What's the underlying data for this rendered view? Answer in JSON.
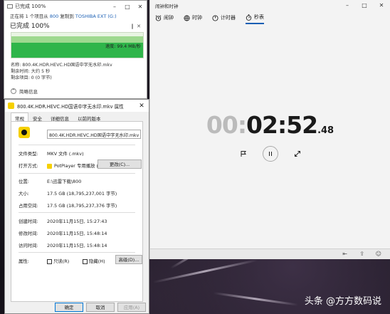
{
  "copy_dialog": {
    "title": "已完成 100%",
    "status_prefix": "正在将 1 个项目从 ",
    "source": "800",
    "status_mid": " 复制到 ",
    "destination": "TOSHIBA EXT (G:)",
    "percent_text": "已完成 100%",
    "speed": "速度: 99.4 MB/秒",
    "progress": 1.0,
    "name_line": "名称: 800.4K.HDR.HEVC.HD国语中字无水印.mkv",
    "remaining_time": "剩余时间: 大约 5 秒",
    "remaining_items": "剩余项目: 0 (0 字节)",
    "less_details": "简略信息"
  },
  "properties": {
    "title": "800.4K.HDR.HEVC.HD国语中字无水印.mkv 属性",
    "tabs": [
      "常规",
      "安全",
      "详细信息",
      "以前的版本"
    ],
    "active_tab": 0,
    "filename": "800.4K.HDR.HEVC.HD国语中字无水印.mkv",
    "file_type_label": "文件类型:",
    "file_type": "MKV 文件 (.mkv)",
    "open_with_label": "打开方式:",
    "open_with": "PotPlayer 专用播放 (6‹",
    "change_button": "更改(C)...",
    "location_label": "位置:",
    "location": "E:\\迅雷下载\\800",
    "size_label": "大小:",
    "size": "17.5 GB (18,795,237,001 字节)",
    "disk_size_label": "占用空间:",
    "disk_size": "17.5 GB (18,795,237,376 字节)",
    "created_label": "创建时间:",
    "created": "2020年11月15日, 15:27:43",
    "modified_label": "修改时间:",
    "modified": "2020年11月15日, 15:48:14",
    "accessed_label": "访问时间:",
    "accessed": "2020年11月15日, 15:48:14",
    "attributes_label": "属性:",
    "readonly_label": "只读(R)",
    "hidden_label": "隐藏(H)",
    "advanced_button": "高级(D)...",
    "ok_button": "确定",
    "cancel_button": "取消",
    "apply_button": "应用(A)"
  },
  "clock": {
    "title": "闹钟和时钟",
    "tabs": [
      {
        "label": "闹钟",
        "icon": "alarm-icon"
      },
      {
        "label": "时钟",
        "icon": "world-clock-icon"
      },
      {
        "label": "计时器",
        "icon": "timer-icon"
      },
      {
        "label": "秒表",
        "icon": "stopwatch-icon"
      }
    ],
    "active_tab": 3,
    "time_dim": "00:",
    "time_main": "02:52",
    "time_ms": ".48",
    "accent": "#1a5fb4"
  },
  "watermark": "头条 @方方数码说"
}
